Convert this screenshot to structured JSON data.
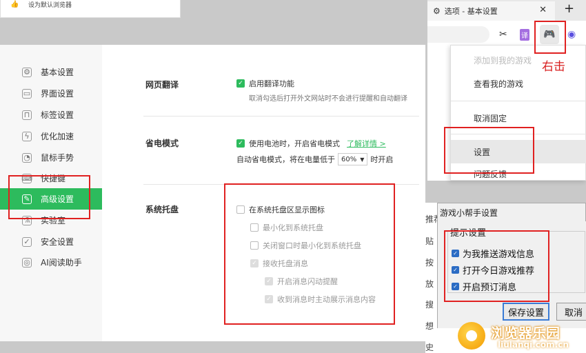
{
  "snippet": {
    "text": "设为默认浏览器"
  },
  "sidebar": {
    "items": [
      {
        "label": "基本设置",
        "icon": "gear-icon"
      },
      {
        "label": "界面设置",
        "icon": "window-icon"
      },
      {
        "label": "标签设置",
        "icon": "tab-icon"
      },
      {
        "label": "优化加速",
        "icon": "lightning-icon"
      },
      {
        "label": "鼠标手势",
        "icon": "mouse-icon"
      },
      {
        "label": "快捷键",
        "icon": "keyboard-icon"
      },
      {
        "label": "高级设置",
        "icon": "wrench-icon",
        "active": true
      },
      {
        "label": "实验室",
        "icon": "flask-icon"
      },
      {
        "label": "安全设置",
        "icon": "shield-icon"
      },
      {
        "label": "AI阅读助手",
        "icon": "ai-icon"
      }
    ]
  },
  "sections": {
    "translate": {
      "title": "网页翻译",
      "option": "启用翻译功能",
      "hint": "取消勾选后打开外文网站时不会进行提醒和自动翻译"
    },
    "power": {
      "title": "省电模式",
      "option": "使用电池时，开启省电模式",
      "link": "了解详情 >",
      "auto_prefix": "自动省电模式，将在电量低于",
      "auto_value": "60%",
      "auto_suffix": "时开启"
    },
    "tray": {
      "title": "系统托盘",
      "main": "在系统托盘区显示图标",
      "opt1": "最小化到系统托盘",
      "opt2": "关闭窗口时最小化到系统托盘",
      "opt3": "接收托盘消息",
      "opt4": "开启消息闪动提醒",
      "opt5": "收到消息时主动展示消息内容"
    }
  },
  "browser": {
    "tab_title": "选项 - 基本设置",
    "menu": {
      "add": "添加到我的游戏",
      "view": "查看我的游戏",
      "unpin": "取消固定",
      "settings": "设置",
      "feedback": "问题反馈"
    },
    "annotation": "右击"
  },
  "dialog": {
    "title": "游戏小帮手设置",
    "group": "提示设置",
    "opt1": "为我推送游戏信息",
    "opt2": "打开今日游戏推荐",
    "opt3": "开启预订消息",
    "save": "保存设置",
    "cancel": "取消"
  },
  "cut_text": [
    "推荐",
    "贴",
    "按",
    "放",
    "搜",
    "想",
    "史"
  ],
  "watermark": {
    "cn": "浏览器乐园",
    "en": "liulanqi.com.cn"
  },
  "colors": {
    "accent": "#2dbb5d",
    "annotation_red": "#e02020",
    "dialog_check": "#2b6cc4"
  }
}
